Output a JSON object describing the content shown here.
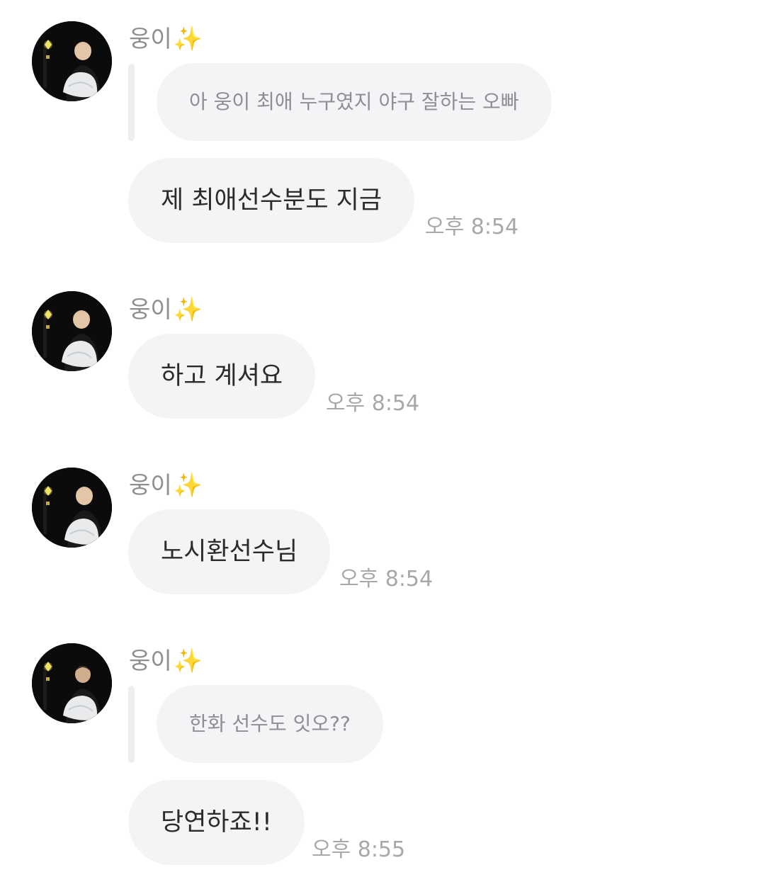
{
  "sender_name": "웅이",
  "sender_emoji": "✨",
  "messages": [
    {
      "quote": "아 웅이 최애 누구였지 야구 잘하는 오빠",
      "text": "제 최애선수분도 지금",
      "time": "오후 8:54"
    },
    {
      "text": "하고 계셔요",
      "time": "오후 8:54"
    },
    {
      "text": "노시환선수님",
      "time": "오후 8:54"
    },
    {
      "quote": "한화 선수도 잇오??",
      "text": "당연하죠!!",
      "time": "오후 8:55"
    }
  ],
  "colors": {
    "bubble_bg": "#f4f4f6",
    "quote_text": "#8e8e93",
    "message_text": "#2b2b2b",
    "timestamp": "#a8a8ac",
    "sparkle": "#f5c518"
  }
}
